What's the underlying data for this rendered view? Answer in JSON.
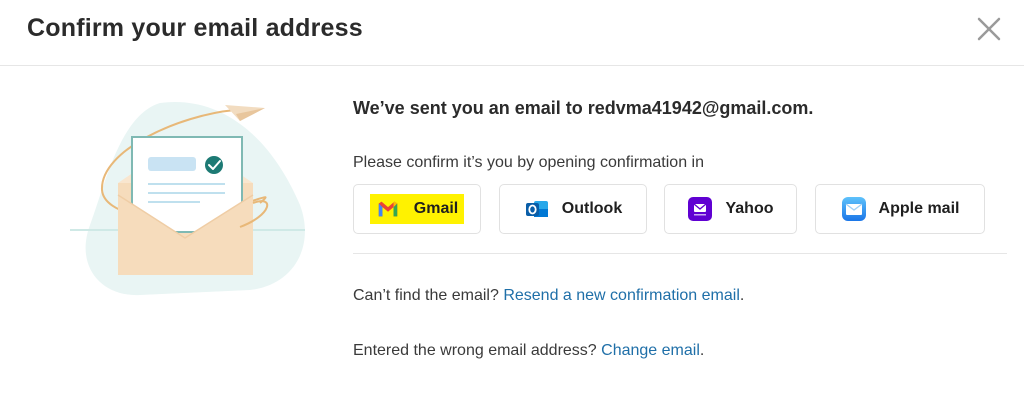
{
  "dialog": {
    "title": "Confirm your email address",
    "close_icon": "close-icon"
  },
  "message": {
    "sent_prefix": "We’ve sent you an email to ",
    "email": "redvma41942@gmail.com.",
    "prompt": "Please confirm it’s you by opening confirmation in"
  },
  "providers": [
    {
      "label": "Gmail",
      "icon": "gmail-icon"
    },
    {
      "label": "Outlook",
      "icon": "outlook-icon"
    },
    {
      "label": "Yahoo",
      "icon": "yahoo-icon"
    },
    {
      "label": "Apple mail",
      "icon": "apple-mail-icon"
    }
  ],
  "resend": {
    "question": "Can’t find the email? ",
    "link": "Resend a new confirmation email",
    "suffix": "."
  },
  "change": {
    "question": "Entered the wrong email address? ",
    "link": "Change email",
    "suffix": "."
  },
  "colors": {
    "link": "#1f6fa8",
    "highlight": "#fff200",
    "envelope": "#f6dcbc",
    "teal": "#1d7a74"
  }
}
